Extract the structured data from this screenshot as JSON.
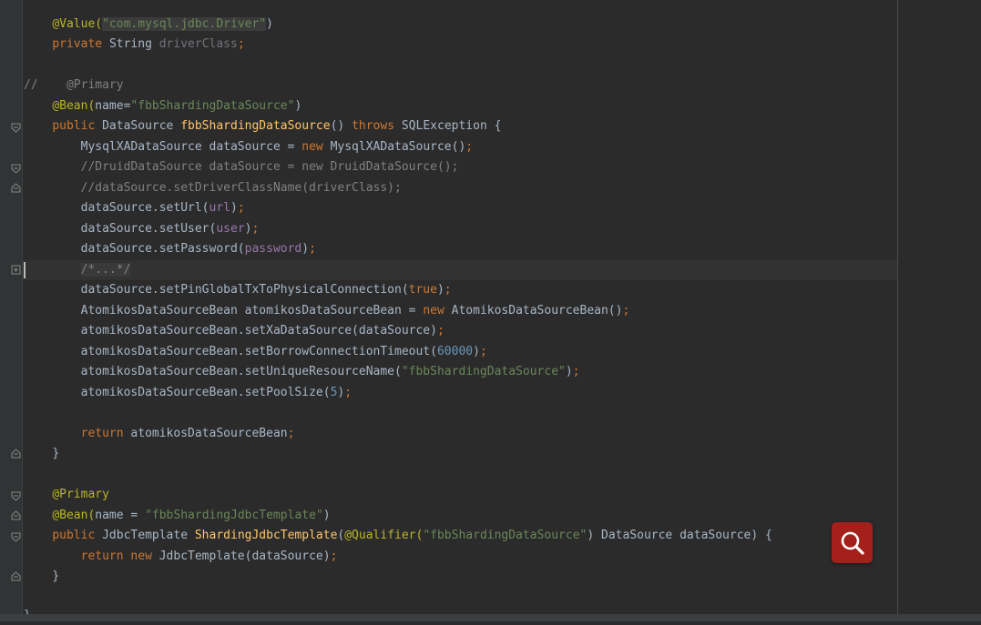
{
  "editor": {
    "theme": {
      "background": "#2b2b2b",
      "keyword": "#cc7832",
      "string": "#6a8759",
      "annotation": "#bbb529",
      "comment": "#808080",
      "field": "#9876aa",
      "method": "#ffc66d",
      "number": "#6897bb"
    },
    "lines": {
      "l1": {
        "ann": "@Value(",
        "str": "\"com.mysql.jdbc.Driver\"",
        "close": ")"
      },
      "l2": {
        "kw": "private ",
        "type": "String ",
        "name": "driverClass",
        "semi": ";"
      },
      "l3": {
        "comment": "//    @Primary"
      },
      "l4": {
        "ann": "@Bean(",
        "attr": "name=",
        "str": "\"fbbShardingDataSource\"",
        "close": ")"
      },
      "l5": {
        "kw": "public ",
        "type": "DataSource ",
        "method": "fbbShardingDataSource",
        "paren": "() ",
        "throws": "throws ",
        "exc": "SQLException {"
      },
      "l6": {
        "decl": "MysqlXADataSource dataSource = ",
        "kw": "new ",
        "ctor": "MysqlXADataSource()",
        "semi": ";"
      },
      "l7": {
        "comment": "//DruidDataSource dataSource = new DruidDataSource();"
      },
      "l8": {
        "comment": "//dataSource.setDriverClassName(driverClass);"
      },
      "l9": {
        "call": "dataSource.setUrl(",
        "field": "url",
        "close": ")",
        "semi": ";"
      },
      "l10": {
        "call": "dataSource.setUser(",
        "field": "user",
        "close": ")",
        "semi": ";"
      },
      "l11": {
        "call": "dataSource.setPassword(",
        "field": "password",
        "close": ")",
        "semi": ";"
      },
      "l12": {
        "folded": "/*...*/"
      },
      "l13": {
        "call": "dataSource.setPinGlobalTxToPhysicalConnection(",
        "kw": "true",
        "close": ")",
        "semi": ";"
      },
      "l14": {
        "decl": "AtomikosDataSourceBean atomikosDataSourceBean = ",
        "kw": "new ",
        "ctor": "AtomikosDataSourceBean()",
        "semi": ";"
      },
      "l15": {
        "call": "atomikosDataSourceBean.setXaDataSource(dataSource)",
        "semi": ";"
      },
      "l16": {
        "call": "atomikosDataSourceBean.setBorrowConnectionTimeout(",
        "num": "60000",
        "close": ")",
        "semi": ";"
      },
      "l17": {
        "call": "atomikosDataSourceBean.setUniqueResourceName(",
        "str": "\"fbbShardingDataSource\"",
        "close": ")",
        "semi": ";"
      },
      "l18": {
        "call": "atomikosDataSourceBean.setPoolSize(",
        "num": "5",
        "close": ")",
        "semi": ";"
      },
      "l19": {
        "kw": "return ",
        "rest": "atomikosDataSourceBean",
        "semi": ";"
      },
      "l20": {
        "brace": "}"
      },
      "l21": {
        "ann": "@Primary"
      },
      "l22": {
        "ann": "@Bean(",
        "attr": "name = ",
        "str": "\"fbbShardingJdbcTemplate\"",
        "close": ")"
      },
      "l23": {
        "kw": "public ",
        "type": "JdbcTemplate ",
        "method": "ShardingJdbcTemplate",
        "open": "(",
        "ann": "@Qualifier(",
        "str": "\"fbbShardingDataSource\"",
        "rest": ") DataSource dataSource) {"
      },
      "l24": {
        "kw": "return new ",
        "rest": "JdbcTemplate(dataSource)",
        "semi": ";"
      },
      "l25": {
        "brace": "}"
      },
      "l26": {
        "brace": "}"
      }
    }
  },
  "search_button": {
    "icon": "search-icon",
    "color": "#a3201b"
  }
}
